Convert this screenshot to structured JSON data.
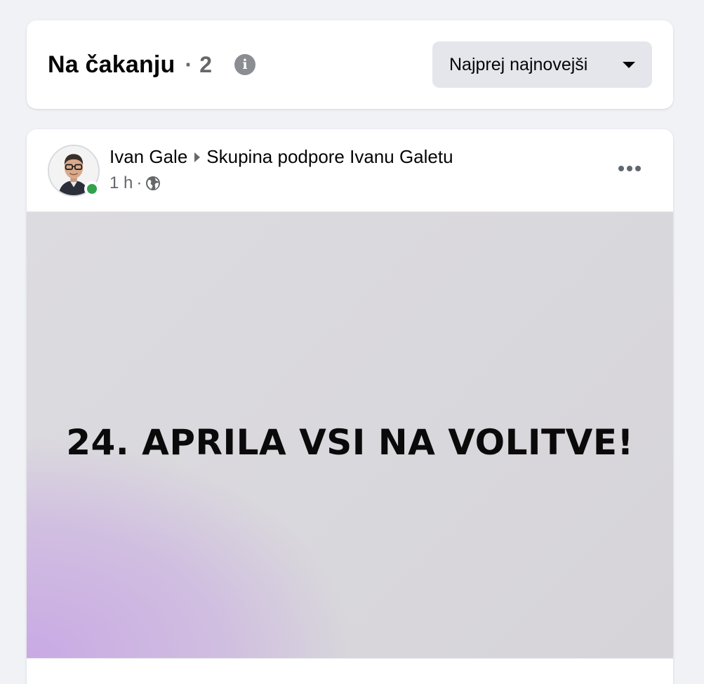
{
  "header": {
    "title": "Na čakanju",
    "separator": "·",
    "count": "2",
    "info_icon": "info-icon",
    "sort_label": "Najprej najnovejši",
    "sort_icon": "caret-down-icon"
  },
  "post": {
    "author": "Ivan Gale",
    "group": "Skupina podpore Ivanu Galetu",
    "time": "1 h",
    "time_separator": "·",
    "audience_icon": "globe-icon",
    "online": true,
    "more_icon": "more-horizontal-icon",
    "image_text": "24. APRILA VSI NA VOLITVE!"
  },
  "colors": {
    "background": "#f0f2f5",
    "card": "#ffffff",
    "button_gray": "#e4e6eb",
    "secondary_text": "#65676b",
    "online_green": "#31a24c",
    "image_purple": "#c9a9e4"
  }
}
